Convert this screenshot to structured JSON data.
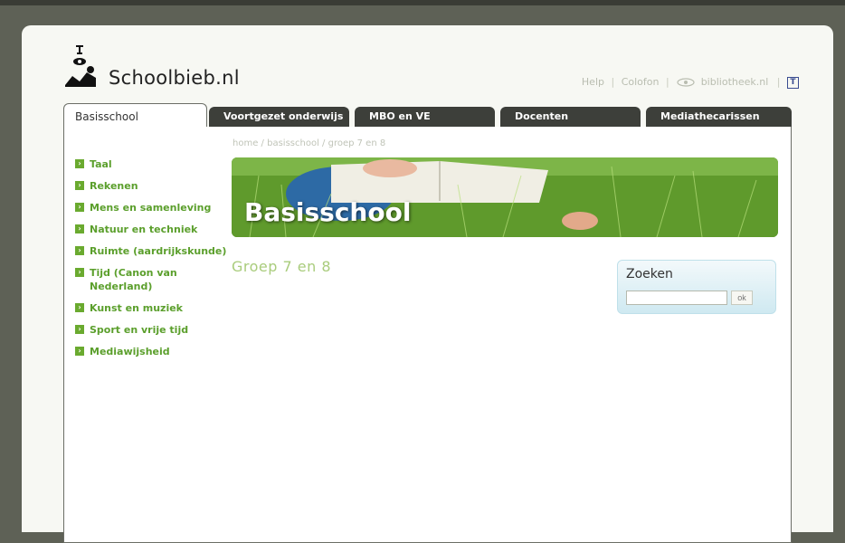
{
  "site": {
    "logo_text": "Schoolbieb.nl",
    "logo_icon": "reading-figure-icon"
  },
  "toplinks": {
    "help": "Help",
    "colofon": "Colofon",
    "bibliotheek": "bibliotheek.nl",
    "text_icon_label": "T"
  },
  "tabs": [
    {
      "label": "Basisschool",
      "active": true
    },
    {
      "label": "Voortgezet onderwijs",
      "active": false
    },
    {
      "label": "MBO en VE",
      "active": false
    },
    {
      "label": "Docenten",
      "active": false
    },
    {
      "label": "Mediathecarissen",
      "active": false
    }
  ],
  "breadcrumb": {
    "home": "home",
    "section": "basisschool",
    "current": "groep 7 en 8",
    "separator": "/"
  },
  "sidebar": {
    "items": [
      {
        "label": "Taal"
      },
      {
        "label": "Rekenen"
      },
      {
        "label": "Mens en samenleving"
      },
      {
        "label": "Natuur en techniek"
      },
      {
        "label": "Ruimte (aardrijkskunde)"
      },
      {
        "label": "Tijd (Canon van Nederland)"
      },
      {
        "label": "Kunst en muziek"
      },
      {
        "label": "Sport en vrije tijd"
      },
      {
        "label": "Mediawijsheid"
      }
    ]
  },
  "banner": {
    "title": "Basisschool"
  },
  "main": {
    "group_title": "Groep 7 en 8"
  },
  "search": {
    "label": "Zoeken",
    "input_value": "",
    "button_label": "ok"
  },
  "colors": {
    "accent_green": "#5b9f2c",
    "tab_dark": "#3d3f3a",
    "search_bg": "#cfe9f1"
  }
}
